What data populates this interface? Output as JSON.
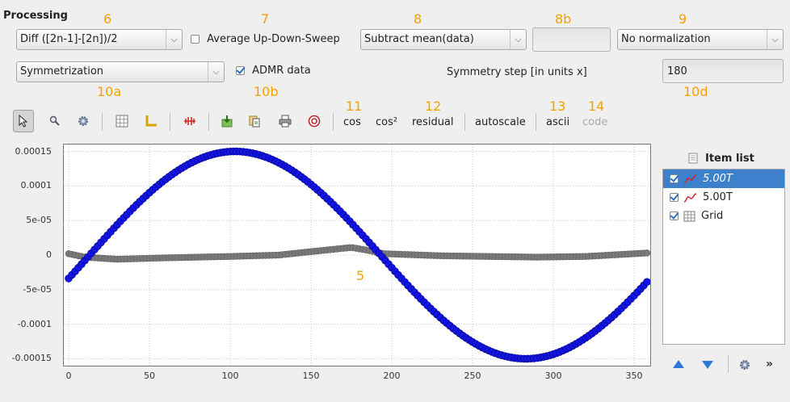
{
  "header": {
    "title": "Processing"
  },
  "annotations": {
    "a6": "6",
    "a7": "7",
    "a8": "8",
    "a8b": "8b",
    "a9": "9",
    "a10a": "10a",
    "a10b": "10b",
    "a10d": "10d",
    "a11": "11",
    "a12": "12",
    "a13": "13",
    "a14": "14",
    "a5": "5"
  },
  "row1": {
    "diff_select": "Diff ([2n-1]-[2n])/2",
    "average_label": "Average Up-Down-Sweep",
    "average_checked": false,
    "subtract_select": "Subtract mean(data)",
    "field_8b": "",
    "normalization_select": "No normalization"
  },
  "row2": {
    "symmetrization_select": "Symmetrization",
    "admr_label": "ADMR data",
    "admr_checked": true,
    "symmetry_step_label": "Symmetry step [in units x]",
    "symmetry_step_value": "180"
  },
  "toolbar": {
    "icons": [
      "pointer-icon",
      "zoom-icon",
      "settings-icon",
      "grid-icon",
      "axes-icon",
      "fit-icon",
      "export-icon",
      "copy-icon",
      "print-icon",
      "help-icon"
    ],
    "cos": "cos",
    "cos2": "cos²",
    "residual": "residual",
    "autoscale": "autoscale",
    "ascii": "ascii",
    "code": "code"
  },
  "item_list": {
    "title": "Item list",
    "items": [
      {
        "label": "5.00T",
        "checked": true,
        "selected": true,
        "italic": true
      },
      {
        "label": "5.00T",
        "checked": true,
        "selected": false,
        "italic": false
      },
      {
        "label": "Grid",
        "checked": true,
        "selected": false,
        "italic": false
      }
    ]
  },
  "chart_data": {
    "type": "scatter",
    "xlim": [
      -3,
      360
    ],
    "ylim": [
      -0.00016,
      0.00016
    ],
    "x_ticks": [
      "0",
      "50",
      "100",
      "150",
      "200",
      "250",
      "300",
      "350"
    ],
    "x_tick_values": [
      0,
      50,
      100,
      150,
      200,
      250,
      300,
      350
    ],
    "y_ticks": [
      "0.00015",
      "0.0001",
      "5e-05",
      "0",
      "-5e-05",
      "-0.0001",
      "-0.00015"
    ],
    "y_tick_values": [
      0.00015,
      0.0001,
      5e-05,
      0,
      -5e-05,
      -0.0001,
      -0.00015
    ],
    "grid": true,
    "series": [
      {
        "name": "5.00T",
        "color": "#1414e0",
        "amplitude": 0.00015,
        "phase_deg": 13,
        "x_start": 0,
        "x_end": 358,
        "x_step": 2
      },
      {
        "name": "5.00T",
        "color": "#7a7a7a",
        "points": [
          [
            0,
            2e-06
          ],
          [
            10,
            -3e-06
          ],
          [
            30,
            -6e-06
          ],
          [
            60,
            -4e-06
          ],
          [
            100,
            -2e-06
          ],
          [
            130,
            0.0
          ],
          [
            150,
            5e-06
          ],
          [
            175,
            1.1e-05
          ],
          [
            185,
            7e-06
          ],
          [
            195,
            2e-06
          ],
          [
            230,
            -1e-06
          ],
          [
            290,
            -3e-06
          ],
          [
            320,
            -2e-06
          ],
          [
            358,
            3e-06
          ]
        ]
      }
    ]
  },
  "colors": {
    "annotation": "#f5a000",
    "selection": "#3d80cc"
  }
}
